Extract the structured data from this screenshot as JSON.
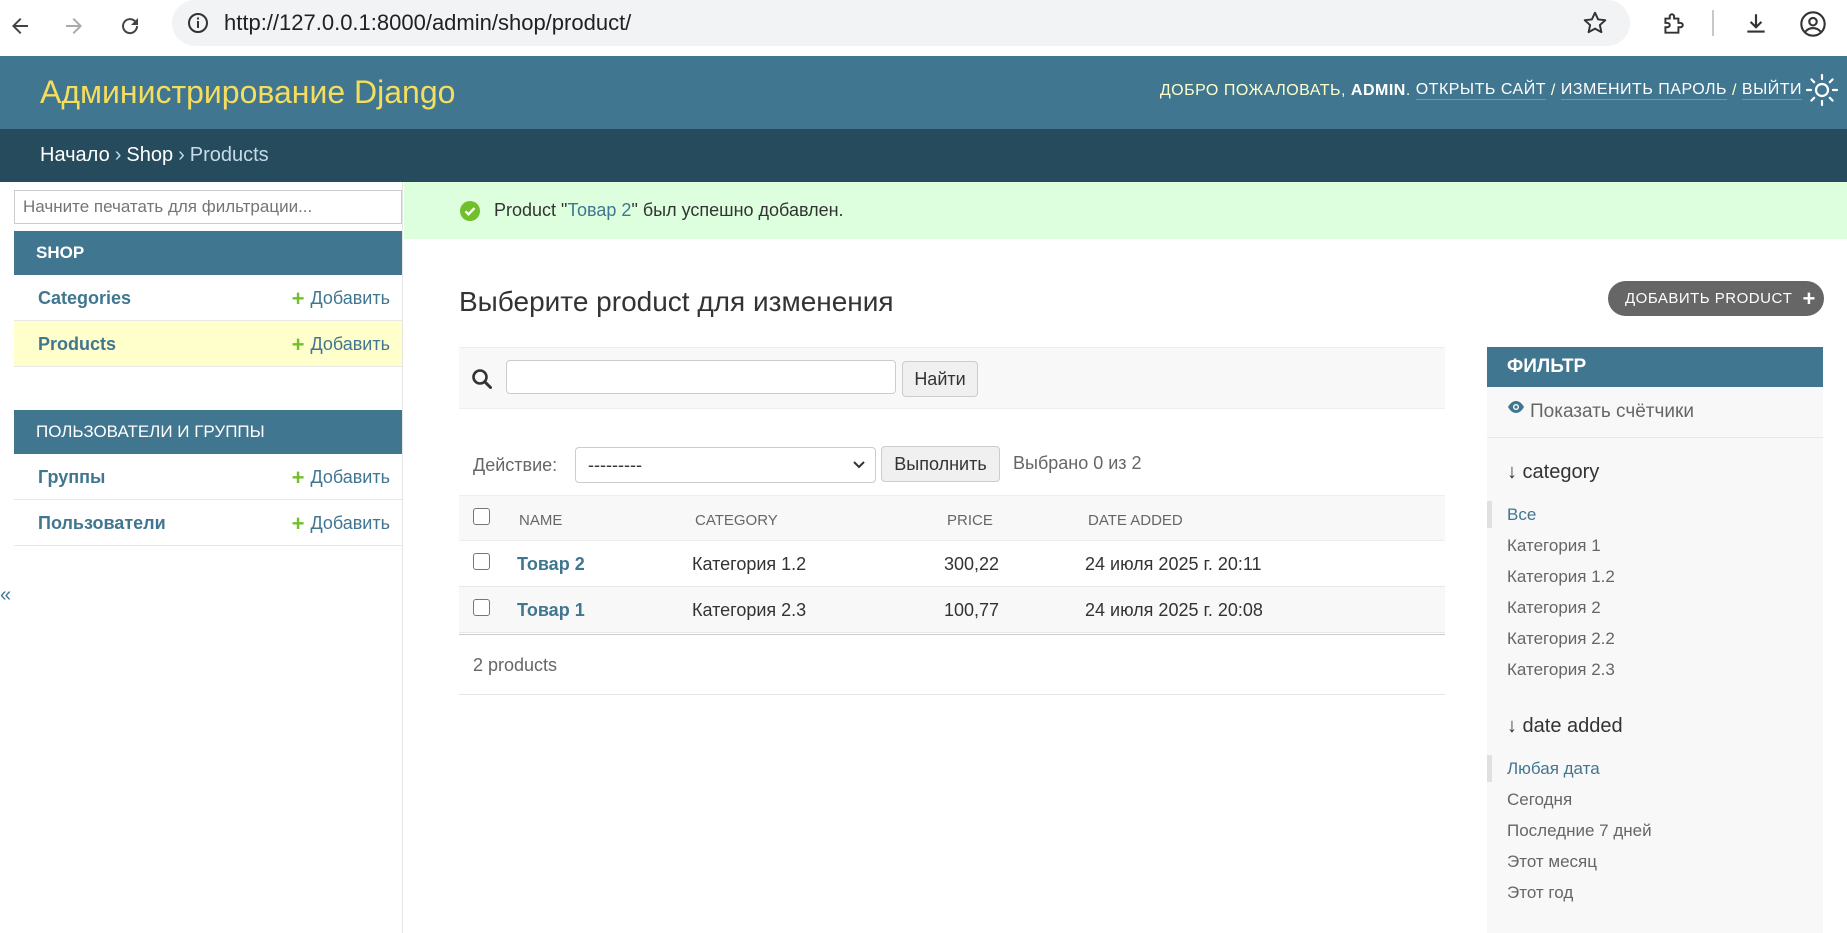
{
  "browser": {
    "url": "http://127.0.0.1:8000/admin/shop/product/"
  },
  "header": {
    "brand": "Администрирование Django",
    "welcome": "Добро пожаловать,",
    "username": "admin",
    "view_site": "Открыть сайт",
    "change_password": "Изменить пароль",
    "logout": "Выйти",
    "sep": "/"
  },
  "breadcrumbs": {
    "home": "Начало",
    "app": "Shop",
    "current": "Products",
    "sep": "›"
  },
  "sidebar": {
    "filter_placeholder": "Начните печатать для фильтрации...",
    "modules": [
      {
        "caption": "Shop",
        "rows": [
          {
            "name": "Categories",
            "add": "Добавить"
          },
          {
            "name": "Products",
            "add": "Добавить"
          }
        ]
      },
      {
        "caption": "Пользователи и группы",
        "rows": [
          {
            "name": "Группы",
            "add": "Добавить"
          },
          {
            "name": "Пользователи",
            "add": "Добавить"
          }
        ]
      }
    ],
    "collapse_glyph": "«"
  },
  "message": {
    "prefix": "Product \"",
    "object": "Товар 2",
    "suffix": "\" был успешно добавлен."
  },
  "main": {
    "title": "Выберите product для изменения",
    "add_button": "Добавить product",
    "search_button": "Найти",
    "action_label": "Действие:",
    "action_selected": "---------",
    "go_button": "Выполнить",
    "selection_counter": "Выбрано 0 из 2",
    "columns": [
      "Name",
      "Category",
      "Price",
      "Date added"
    ],
    "rows": [
      {
        "name": "Товар 2",
        "category": "Категория 1.2",
        "price": "300,22",
        "date": "24 июля 2025 г. 20:11"
      },
      {
        "name": "Товар 1",
        "category": "Категория 2.3",
        "price": "100,77",
        "date": "24 июля 2025 г. 20:08"
      }
    ],
    "paginator": "2 products"
  },
  "filter": {
    "title": "Фильтр",
    "show_counts": "Показать счётчики",
    "groups": [
      {
        "title": "↓ category",
        "items": [
          "Все",
          "Категория 1",
          "Категория 1.2",
          "Категория 2",
          "Категория 2.2",
          "Категория 2.3"
        ],
        "selected": 0
      },
      {
        "title": "↓ date added",
        "items": [
          "Любая дата",
          "Сегодня",
          "Последние 7 дней",
          "Этот месяц",
          "Этот год"
        ],
        "selected": 0
      }
    ]
  },
  "colors": {
    "primary": "#417690",
    "breadcrumbs_bg": "#264b5d",
    "brand_text": "#f5dd5d",
    "success_bg": "#ddffdd",
    "selected_row_bg": "#ffffcc",
    "add_green": "#70bf2b"
  }
}
